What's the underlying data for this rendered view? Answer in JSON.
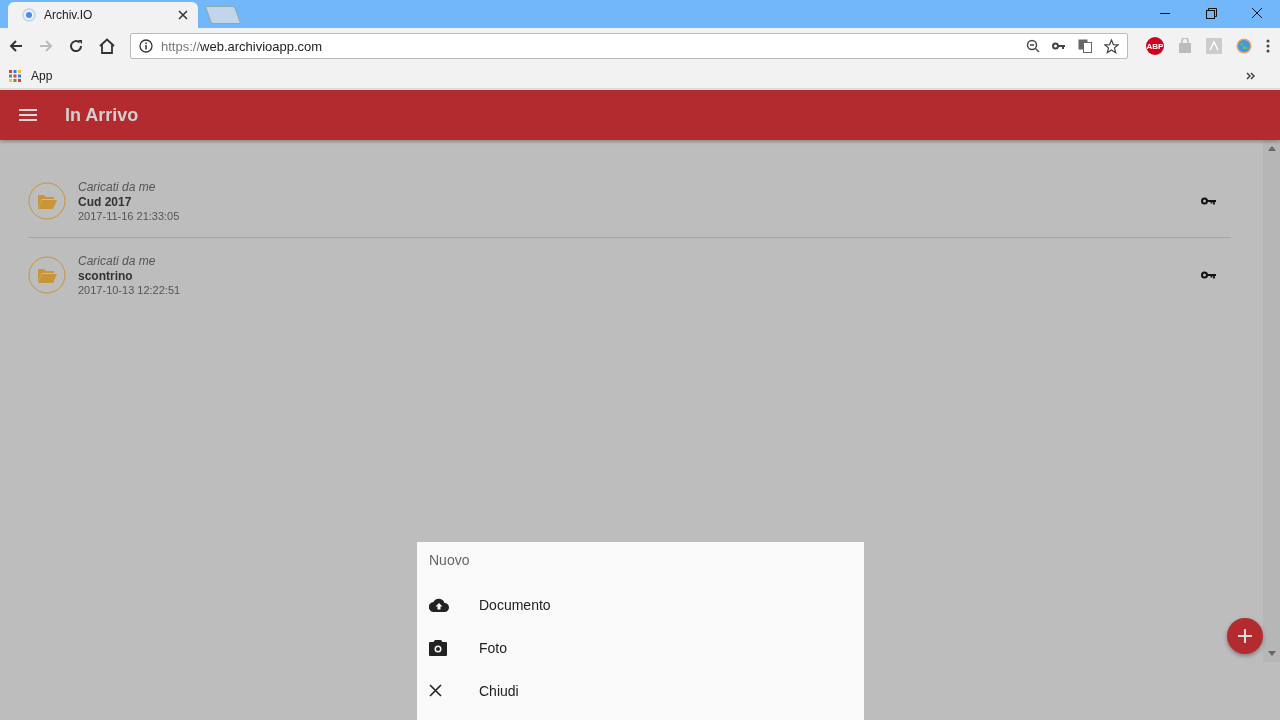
{
  "browser": {
    "tab_title": "Archiv.IO",
    "url_scheme": "https://",
    "url_host": "web.archivioapp.com",
    "bookmarks": [
      {
        "label": "App"
      }
    ],
    "extension_badge": "ABP"
  },
  "app_bar": {
    "title": "In Arrivo"
  },
  "items": [
    {
      "source": "Caricati da me",
      "name": "Cud 2017",
      "date": "2017-11-16 21:33:05"
    },
    {
      "source": "Caricati da me",
      "name": "scontrino",
      "date": "2017-10-13 12:22:51"
    }
  ],
  "sheet": {
    "title": "Nuovo",
    "actions": [
      {
        "kind": "upload",
        "label": "Documento"
      },
      {
        "kind": "camera",
        "label": "Foto"
      },
      {
        "kind": "close",
        "label": "Chiudi"
      }
    ]
  }
}
